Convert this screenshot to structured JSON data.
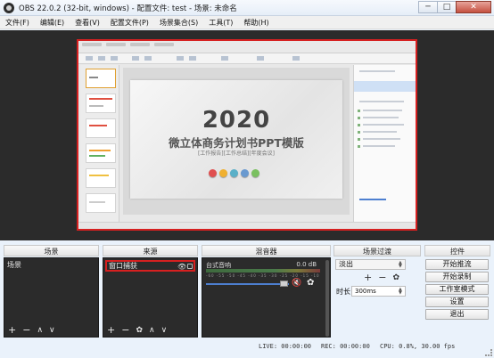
{
  "window": {
    "title": "OBS 22.0.2 (32-bit, windows) - 配置文件: test - 场景: 未命名",
    "minimize": "─",
    "maximize": "□",
    "close": "✕"
  },
  "menu": [
    "文件(F)",
    "编辑(E)",
    "查看(V)",
    "配置文件(P)",
    "场景集合(S)",
    "工具(T)",
    "帮助(H)"
  ],
  "preview": {
    "slide_year": "2020",
    "slide_title": "微立体商务计划书PPT模版",
    "slide_subtitle": "[工作报告][工作总结][年度会议]",
    "dot_colors": [
      "#e05050",
      "#f0b030",
      "#5ab0c8",
      "#6a9ad0",
      "#7ac060"
    ]
  },
  "docks": {
    "scenes": {
      "title": "场景",
      "items": [
        "场景"
      ]
    },
    "sources": {
      "title": "来源",
      "items": [
        "窗口捕获"
      ]
    },
    "mixer": {
      "title": "混音器",
      "channel_name": "台式音响",
      "db_value": "0.0 dB",
      "volume_level": 0.95,
      "ticks": "-60 -55 -50 -45 -40 -35 -30 -25 -20 -15 -10 -5 0"
    },
    "transitions": {
      "title": "场景过渡",
      "selected": "淡出",
      "duration_label": "时长",
      "duration_value": "300ms"
    },
    "controls": {
      "title": "控件",
      "buttons": [
        "开始推流",
        "开始录制",
        "工作室模式",
        "设置",
        "退出"
      ]
    }
  },
  "toolbar_glyphs": {
    "add": "+",
    "remove": "−",
    "up": "∧",
    "down": "∨",
    "gear": "✿",
    "eye": "👁"
  },
  "status": {
    "live": "LIVE: 00:00:00",
    "rec": "REC: 00:00:00",
    "cpu": "CPU: 0.8%, 30.00 fps"
  },
  "colors": {
    "accent_red": "#d62020",
    "panel_dark": "#2b2b2b",
    "window_bg": "#eaf2fb"
  }
}
